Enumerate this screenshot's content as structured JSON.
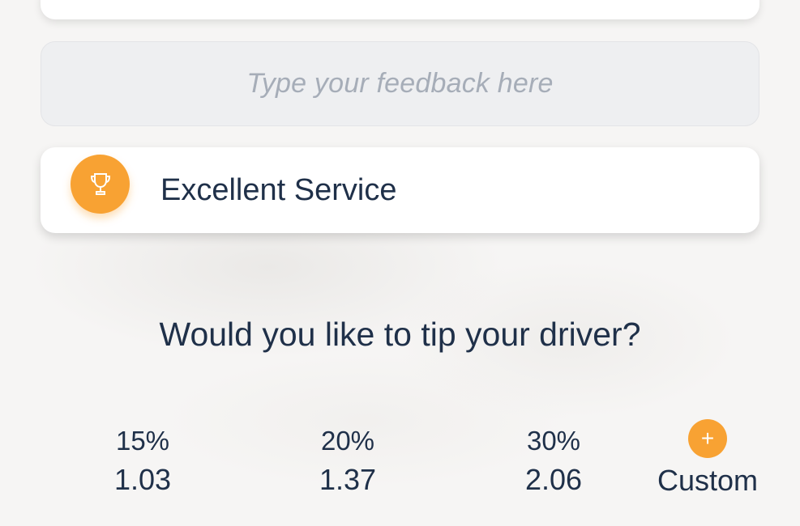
{
  "feedback": {
    "placeholder": "Type your feedback here"
  },
  "service_badge": {
    "icon": "trophy-icon",
    "label": "Excellent Service",
    "accent_color": "#f8a233"
  },
  "tip": {
    "question": "Would you like to tip your driver?",
    "options": [
      {
        "percent": "15%",
        "amount": "1.03"
      },
      {
        "percent": "20%",
        "amount": "1.37"
      },
      {
        "percent": "30%",
        "amount": "2.06"
      }
    ],
    "custom": {
      "icon": "plus-icon",
      "glyph": "+",
      "label": "Custom"
    }
  },
  "colors": {
    "text": "#1f3049",
    "accent": "#f8a233",
    "placeholder": "#a6adb8",
    "background": "#f6f5f4"
  }
}
